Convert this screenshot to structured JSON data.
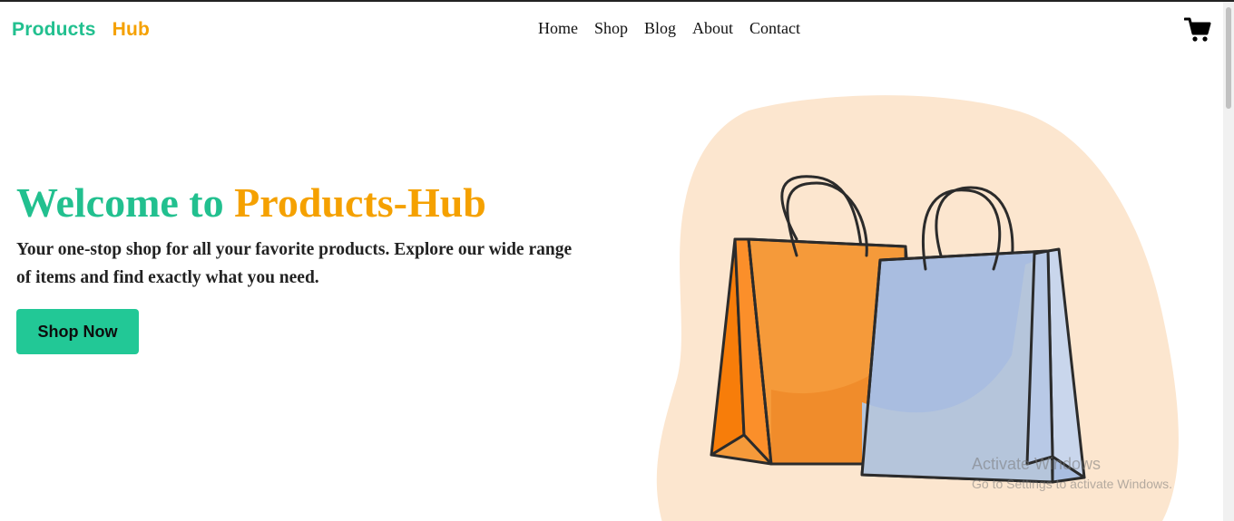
{
  "header": {
    "logo_part1": "Products",
    "logo_part2": "Hub",
    "nav": [
      "Home",
      "Shop",
      "Blog",
      "About",
      "Contact"
    ],
    "cart_icon": "shopping-cart-icon"
  },
  "hero": {
    "title_part1": "Welcome to",
    "title_part2": "Products-Hub",
    "subtitle": "Your one-stop shop for all your favorite products. Explore our wide range of items and find exactly what you need.",
    "cta_label": "Shop Now",
    "illustration": "shopping-bags-illustration"
  },
  "watermark": {
    "title": "Activate Windows",
    "subtitle": "Go to Settings to activate Windows."
  },
  "colors": {
    "brand_green": "#22c08f",
    "brand_orange": "#f5a100",
    "button_bg": "#22c896",
    "blob": "#fce6cf",
    "bag_orange": "#f59a3a",
    "bag_blue": "#a9bde0"
  }
}
